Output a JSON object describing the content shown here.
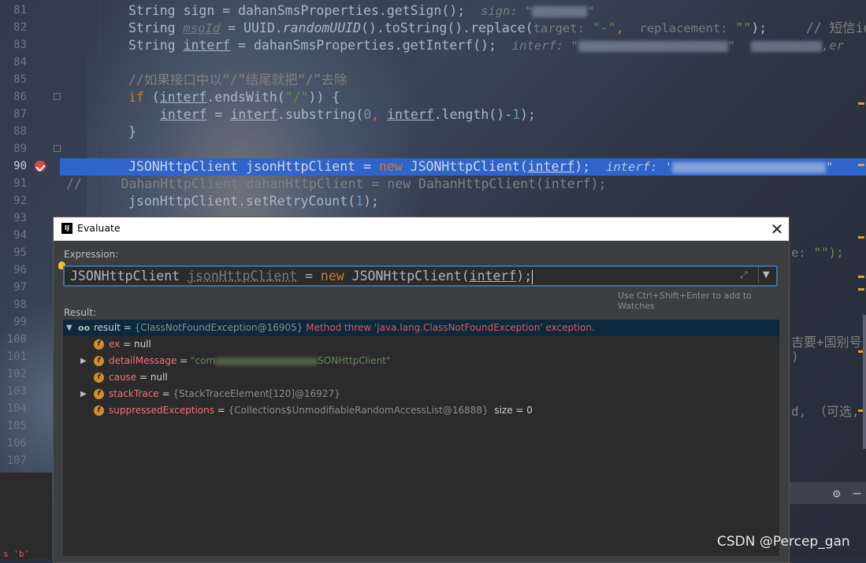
{
  "editor": {
    "line_numbers": [
      "81",
      "82",
      "83",
      "84",
      "85",
      "86",
      "87",
      "88",
      "89",
      "90",
      "91",
      "92",
      "93",
      "94",
      "95",
      "96",
      "97",
      "98",
      "99",
      "100",
      "101",
      "102",
      "103",
      "104",
      "105",
      "106",
      "107"
    ],
    "current_line": "90",
    "lines": {
      "l81_a": "String sign = dahanSmsProperties.getSign();",
      "l81_hint": "sign: \"",
      "l81_hint_end": "\"",
      "l82_a": "String ",
      "l82_var": "msgId",
      "l82_b": " = UUID.",
      "l82_method": "randomUUID",
      "l82_c": "().toString().replace(",
      "l82_hint1": "target:",
      "l82_str1": "\"-\"",
      "l82_comma": ",",
      "l82_hint2": "replacement:",
      "l82_str2": "\"\"",
      "l82_end": ");",
      "l82_comment": "// 短信id,",
      "l83_a": "String ",
      "l83_var": "interf",
      "l83_b": " = dahanSmsProperties.getInterf();",
      "l83_hint": "interf: \"",
      "l83_hint_end": "\"",
      "l83_tail": ",er",
      "l85_comment": "//如果接口中以“/”结尾就把“/”去除",
      "l86_kw": "if",
      "l86_a": " (",
      "l86_var": "interf",
      "l86_b": ".endsWith(",
      "l86_str": "\"/\"",
      "l86_c": ")) {",
      "l87_var1": "interf",
      "l87_a": " = ",
      "l87_var2": "interf",
      "l87_b": ".substring(",
      "l87_num0": "0",
      "l87_c": ", ",
      "l87_var3": "interf",
      "l87_d": ".length()-",
      "l87_num1": "1",
      "l87_e": ");",
      "l88": "}",
      "l90_a": "JSONHttpClient jsonHttpClient = ",
      "l90_kw": "new",
      "l90_b": " JSONHttpClient(",
      "l90_var": "interf",
      "l90_c": ");",
      "l90_hint": "interf: '",
      "l90_hint_end": "\"",
      "l91_comment": "//     DahanHttpClient dahanHttpClient = new DahanHttpClient(interf);",
      "l92_a": "jsonHttpClient.setRetryCount(",
      "l92_num": "1",
      "l92_b": ");",
      "l95_right_hint": "e:",
      "l95_right_code": "\"\");",
      "l100_right": "吉要+国别号",
      "l101_right": ")",
      "l104_right": "d, （可选,"
    },
    "watermark": "CSDN @Percep_gan",
    "bottom_left_text": "s 'b'"
  },
  "dialog": {
    "title": "Evaluate",
    "expression_label": "Expression:",
    "expression": {
      "type": "JSONHttpClient",
      "var": "jsonHttpClient",
      "eq": " = ",
      "kw": "new",
      "ctor": " JSONHttpClient(",
      "arg": "interf",
      "end": ");"
    },
    "watches_hint": "Use Ctrl+Shift+Enter to add to Watches",
    "result_label": "Result:",
    "result": {
      "name": "result",
      "eq": " = ",
      "value": "{ClassNotFoundException@16905}",
      "message": "Method threw 'java.lang.ClassNotFoundException' exception."
    },
    "fields": [
      {
        "name": "ex",
        "eq": " = ",
        "value": "null"
      },
      {
        "name": "detailMessage",
        "eq": " = ",
        "value_start": "\"com",
        "value_end": "SONHttpClient\""
      },
      {
        "name": "cause",
        "eq": " = ",
        "value": "null"
      },
      {
        "name": "stackTrace",
        "eq": " = ",
        "value": "{StackTraceElement[120]@16927}"
      },
      {
        "name": "suppressedExceptions",
        "eq": " = ",
        "value": "{Collections$UnmodifiableRandomAccessList@16888}",
        "extra": "size = 0"
      }
    ]
  },
  "icons": {
    "close": "close-icon",
    "expand": "expand-icon",
    "dropdown": "chevron-down-icon",
    "gear": "gear-icon",
    "minimize": "minimize-icon",
    "breakpoint": "breakpoint-icon",
    "bulb": "lightbulb-icon"
  }
}
